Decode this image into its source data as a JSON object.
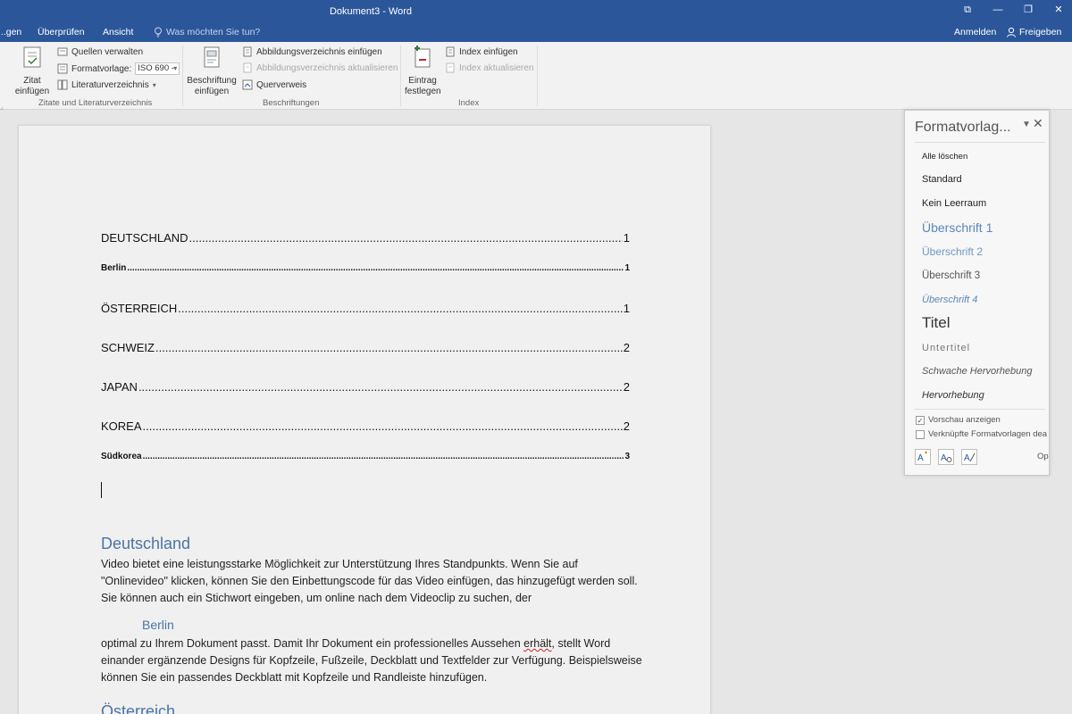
{
  "window": {
    "title": "Dokument3 - Word",
    "tabs": [
      "...gen",
      "Überprüfen",
      "Ansicht"
    ],
    "tell_me": "Was möchten Sie tun?",
    "sign_in": "Anmelden",
    "share": "Freigeben"
  },
  "ribbon": {
    "citations": {
      "insert_citation": "Zitat einfügen",
      "manage_sources": "Quellen verwalten",
      "style_label": "Formatvorlage:",
      "style_value": "ISO 690 -",
      "bibliography": "Literaturverzeichnis",
      "group_label": "Zitate und Literaturverzeichnis"
    },
    "captions": {
      "insert_caption": "Beschriftung einfügen",
      "insert_table_of_figures": "Abbildungsverzeichnis einfügen",
      "update_table": "Abbildungsverzeichnis aktualisieren",
      "cross_reference": "Querverweis",
      "group_label": "Beschriftungen"
    },
    "index": {
      "mark_entry": "Eintrag festlegen",
      "insert_index": "Index einfügen",
      "update_index": "Index aktualisieren",
      "group_label": "Index"
    }
  },
  "document": {
    "toc": [
      {
        "label": "DEUTSCHLAND",
        "page": "1",
        "level": 1
      },
      {
        "label": "Berlin",
        "page": "1",
        "level": 2
      },
      {
        "label": "ÖSTERREICH",
        "page": "1",
        "level": 1
      },
      {
        "label": "SCHWEIZ",
        "page": "2",
        "level": 1
      },
      {
        "label": "JAPAN",
        "page": "2",
        "level": 1
      },
      {
        "label": "KOREA",
        "page": "2",
        "level": 1
      },
      {
        "label": "Südkorea",
        "page": "3",
        "level": 2
      }
    ],
    "heading1": "Deutschland",
    "para1": "Video bietet eine leistungsstarke Möglichkeit zur Unterstützung Ihres Standpunkts. Wenn Sie auf \"Onlinevideo\" klicken, können Sie den Einbettungscode für das Video einfügen, das hinzugefügt werden soll. Sie können auch ein Stichwort eingeben, um online nach dem Videoclip zu suchen, der",
    "heading2": "Berlin",
    "para2_before": "optimal zu Ihrem Dokument passt. Damit Ihr Dokument ein professionelles Aussehen ",
    "para2_squiggle": "erhält",
    "para2_after": ", stellt Word einander ergänzende Designs für Kopfzeile, Fußzeile, Deckblatt und Textfelder zur Verfügung. Beispielsweise können Sie ein passendes Deckblatt mit Kopfzeile und Randleiste hinzufügen.",
    "heading3": "Österreich"
  },
  "styles_pane": {
    "title": "Formatvorlag...",
    "styles": [
      "Alle löschen",
      "Standard",
      "Kein Leerraum",
      "Überschrift 1",
      "Überschrift 2",
      "Überschrift 3",
      "Überschrift 4",
      "Titel",
      "Untertitel",
      "Schwache Hervorhebung",
      "Hervorhebung"
    ],
    "show_preview": "Vorschau anzeigen",
    "show_preview_checked": true,
    "linked_styles": "Verknüpfte Formatvorlagen dea",
    "linked_styles_checked": false,
    "options": "Op"
  },
  "colors": {
    "title_bar": "#2b579a",
    "heading_blue": "#4a74a8"
  }
}
